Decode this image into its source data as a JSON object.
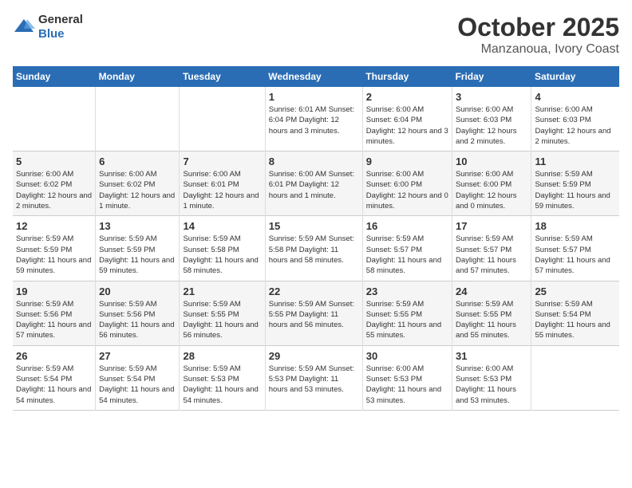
{
  "header": {
    "logo_general": "General",
    "logo_blue": "Blue",
    "month_title": "October 2025",
    "subtitle": "Manzanoua, Ivory Coast"
  },
  "weekdays": [
    "Sunday",
    "Monday",
    "Tuesday",
    "Wednesday",
    "Thursday",
    "Friday",
    "Saturday"
  ],
  "weeks": [
    [
      {
        "day": "",
        "info": ""
      },
      {
        "day": "",
        "info": ""
      },
      {
        "day": "",
        "info": ""
      },
      {
        "day": "1",
        "info": "Sunrise: 6:01 AM\nSunset: 6:04 PM\nDaylight: 12 hours\nand 3 minutes."
      },
      {
        "day": "2",
        "info": "Sunrise: 6:00 AM\nSunset: 6:04 PM\nDaylight: 12 hours\nand 3 minutes."
      },
      {
        "day": "3",
        "info": "Sunrise: 6:00 AM\nSunset: 6:03 PM\nDaylight: 12 hours\nand 2 minutes."
      },
      {
        "day": "4",
        "info": "Sunrise: 6:00 AM\nSunset: 6:03 PM\nDaylight: 12 hours\nand 2 minutes."
      }
    ],
    [
      {
        "day": "5",
        "info": "Sunrise: 6:00 AM\nSunset: 6:02 PM\nDaylight: 12 hours\nand 2 minutes."
      },
      {
        "day": "6",
        "info": "Sunrise: 6:00 AM\nSunset: 6:02 PM\nDaylight: 12 hours\nand 1 minute."
      },
      {
        "day": "7",
        "info": "Sunrise: 6:00 AM\nSunset: 6:01 PM\nDaylight: 12 hours\nand 1 minute."
      },
      {
        "day": "8",
        "info": "Sunrise: 6:00 AM\nSunset: 6:01 PM\nDaylight: 12 hours\nand 1 minute."
      },
      {
        "day": "9",
        "info": "Sunrise: 6:00 AM\nSunset: 6:00 PM\nDaylight: 12 hours\nand 0 minutes."
      },
      {
        "day": "10",
        "info": "Sunrise: 6:00 AM\nSunset: 6:00 PM\nDaylight: 12 hours\nand 0 minutes."
      },
      {
        "day": "11",
        "info": "Sunrise: 5:59 AM\nSunset: 5:59 PM\nDaylight: 11 hours\nand 59 minutes."
      }
    ],
    [
      {
        "day": "12",
        "info": "Sunrise: 5:59 AM\nSunset: 5:59 PM\nDaylight: 11 hours\nand 59 minutes."
      },
      {
        "day": "13",
        "info": "Sunrise: 5:59 AM\nSunset: 5:59 PM\nDaylight: 11 hours\nand 59 minutes."
      },
      {
        "day": "14",
        "info": "Sunrise: 5:59 AM\nSunset: 5:58 PM\nDaylight: 11 hours\nand 58 minutes."
      },
      {
        "day": "15",
        "info": "Sunrise: 5:59 AM\nSunset: 5:58 PM\nDaylight: 11 hours\nand 58 minutes."
      },
      {
        "day": "16",
        "info": "Sunrise: 5:59 AM\nSunset: 5:57 PM\nDaylight: 11 hours\nand 58 minutes."
      },
      {
        "day": "17",
        "info": "Sunrise: 5:59 AM\nSunset: 5:57 PM\nDaylight: 11 hours\nand 57 minutes."
      },
      {
        "day": "18",
        "info": "Sunrise: 5:59 AM\nSunset: 5:57 PM\nDaylight: 11 hours\nand 57 minutes."
      }
    ],
    [
      {
        "day": "19",
        "info": "Sunrise: 5:59 AM\nSunset: 5:56 PM\nDaylight: 11 hours\nand 57 minutes."
      },
      {
        "day": "20",
        "info": "Sunrise: 5:59 AM\nSunset: 5:56 PM\nDaylight: 11 hours\nand 56 minutes."
      },
      {
        "day": "21",
        "info": "Sunrise: 5:59 AM\nSunset: 5:55 PM\nDaylight: 11 hours\nand 56 minutes."
      },
      {
        "day": "22",
        "info": "Sunrise: 5:59 AM\nSunset: 5:55 PM\nDaylight: 11 hours\nand 56 minutes."
      },
      {
        "day": "23",
        "info": "Sunrise: 5:59 AM\nSunset: 5:55 PM\nDaylight: 11 hours\nand 55 minutes."
      },
      {
        "day": "24",
        "info": "Sunrise: 5:59 AM\nSunset: 5:55 PM\nDaylight: 11 hours\nand 55 minutes."
      },
      {
        "day": "25",
        "info": "Sunrise: 5:59 AM\nSunset: 5:54 PM\nDaylight: 11 hours\nand 55 minutes."
      }
    ],
    [
      {
        "day": "26",
        "info": "Sunrise: 5:59 AM\nSunset: 5:54 PM\nDaylight: 11 hours\nand 54 minutes."
      },
      {
        "day": "27",
        "info": "Sunrise: 5:59 AM\nSunset: 5:54 PM\nDaylight: 11 hours\nand 54 minutes."
      },
      {
        "day": "28",
        "info": "Sunrise: 5:59 AM\nSunset: 5:53 PM\nDaylight: 11 hours\nand 54 minutes."
      },
      {
        "day": "29",
        "info": "Sunrise: 5:59 AM\nSunset: 5:53 PM\nDaylight: 11 hours\nand 53 minutes."
      },
      {
        "day": "30",
        "info": "Sunrise: 6:00 AM\nSunset: 5:53 PM\nDaylight: 11 hours\nand 53 minutes."
      },
      {
        "day": "31",
        "info": "Sunrise: 6:00 AM\nSunset: 5:53 PM\nDaylight: 11 hours\nand 53 minutes."
      },
      {
        "day": "",
        "info": ""
      }
    ]
  ]
}
